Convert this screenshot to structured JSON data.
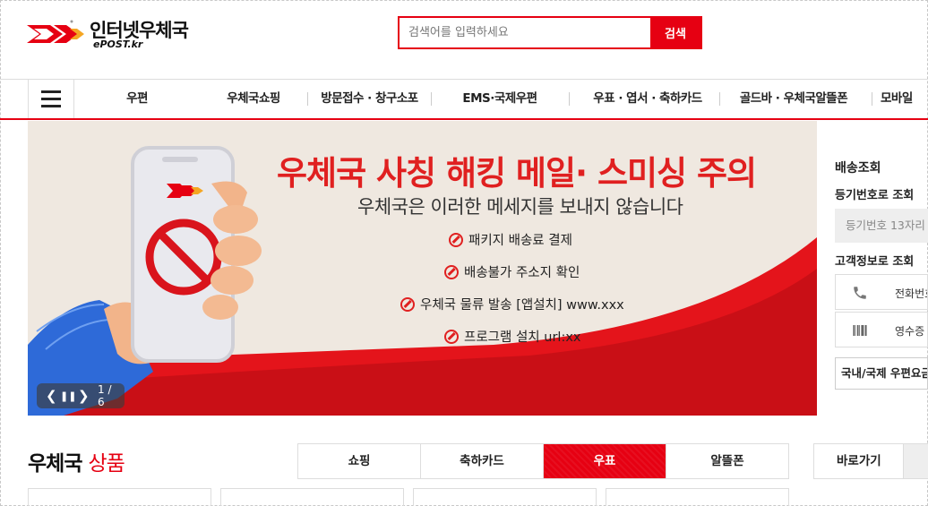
{
  "header": {
    "logo_title": "인터넷우체국",
    "logo_sub": "ePOST.kr",
    "search_placeholder": "검색어를 입력하세요",
    "search_button": "검색"
  },
  "nav": {
    "items": [
      "우편",
      "우체국쇼핑",
      "방문접수 · 창구소포",
      "EMS·국제우편",
      "우표 · 엽서 · 축하카드",
      "골드바 · 우체국알뜰폰",
      "모바일"
    ]
  },
  "banner": {
    "title": "우체국 사칭 해킹 메일· 스미싱 주의",
    "subtitle": "우체국은 이러한 메세지를 보내지 않습니다",
    "warnings": [
      "패키지 배송료 결제",
      "배송불가 주소지 확인",
      "우체국 물류 발송 [앱설치] www.xxx",
      "프로그램 설치 url:xx"
    ],
    "slide_count": "1 / 6",
    "prev_glyph": "❮",
    "pause_glyph": "❚❚",
    "next_glyph": "❯"
  },
  "tracking": {
    "title": "배송조회",
    "by_number_label": "등기번호로 조회",
    "number_placeholder": "등기번호 13자리",
    "by_customer_label": "고객정보로 조회",
    "phone_button": "전화번호",
    "receipt_button": "영수증",
    "rate_button": "국내/국제 우편요금"
  },
  "products": {
    "title_black": "우체국",
    "title_red": "상품",
    "tabs": [
      "쇼핑",
      "축하카드",
      "우표",
      "알뜰폰"
    ],
    "active_tab": "우표",
    "shortcut_label": "바로가기"
  },
  "colors": {
    "brand_red": "#e60012",
    "banner_bg": "#efe8e0"
  },
  "icons": [
    "hamburger-icon",
    "search-icon",
    "phone-icon",
    "barcode-icon",
    "prohibited-icon",
    "logo-mark-icon"
  ]
}
